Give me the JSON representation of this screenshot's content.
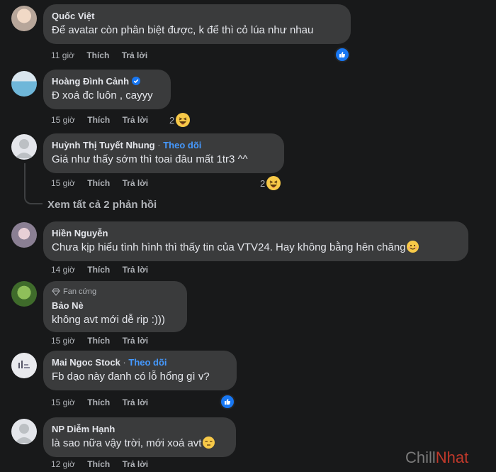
{
  "comments": [
    {
      "name": "Quốc Việt",
      "text": "Để avatar còn phân biệt được, k để thì cỏ lúa như nhau",
      "time": "11 giờ",
      "like": "Thích",
      "reply": "Trả lời"
    },
    {
      "name": "Hoàng Đình Cảnh",
      "text": "Đ xoá đc luôn , cayyy",
      "time": "15 giờ",
      "like": "Thích",
      "reply": "Trả lời",
      "reactions": "2"
    },
    {
      "name": "Huỳnh Thị Tuyết Nhung",
      "sep": "·",
      "follow": "Theo dõi",
      "text": "Giá như thấy sớm thì toai đâu mất 1tr3 ^^",
      "time": "15 giờ",
      "like": "Thích",
      "reply": "Trả lời",
      "reactions": "2"
    },
    {
      "name": "Hiền Nguyễn",
      "text": "Chưa kịp hiểu tình hình thì thấy tin của VTV24. Hay không bằng hên chăng",
      "time": "14 giờ",
      "like": "Thích",
      "reply": "Trả lời"
    },
    {
      "badge": "Fan cứng",
      "name": "Bảo Nè",
      "text": "không avt mới dễ rip :)))",
      "time": "15 giờ",
      "like": "Thích",
      "reply": "Trả lời"
    },
    {
      "name": "Mai Ngoc Stock",
      "sep": "·",
      "follow": "Theo dõi",
      "text": "Fb dạo này đanh có lỗ hổng gì v?",
      "time": "15 giờ",
      "like": "Thích",
      "reply": "Trả lời"
    },
    {
      "name": "NP Diễm Hạnh",
      "text": "là sao nữa vậy trời, mới xoá avt",
      "time": "12 giờ",
      "like": "Thích",
      "reply": "Trả lời"
    }
  ],
  "see_all_replies": "Xem tất cả 2 phản hồi",
  "watermark": {
    "part1": "Chill",
    "part2": "Nhat"
  },
  "colors": {
    "background": "#18191a",
    "bubble": "#3a3b3c",
    "link": "#4599ff",
    "like": "#1877f2"
  }
}
